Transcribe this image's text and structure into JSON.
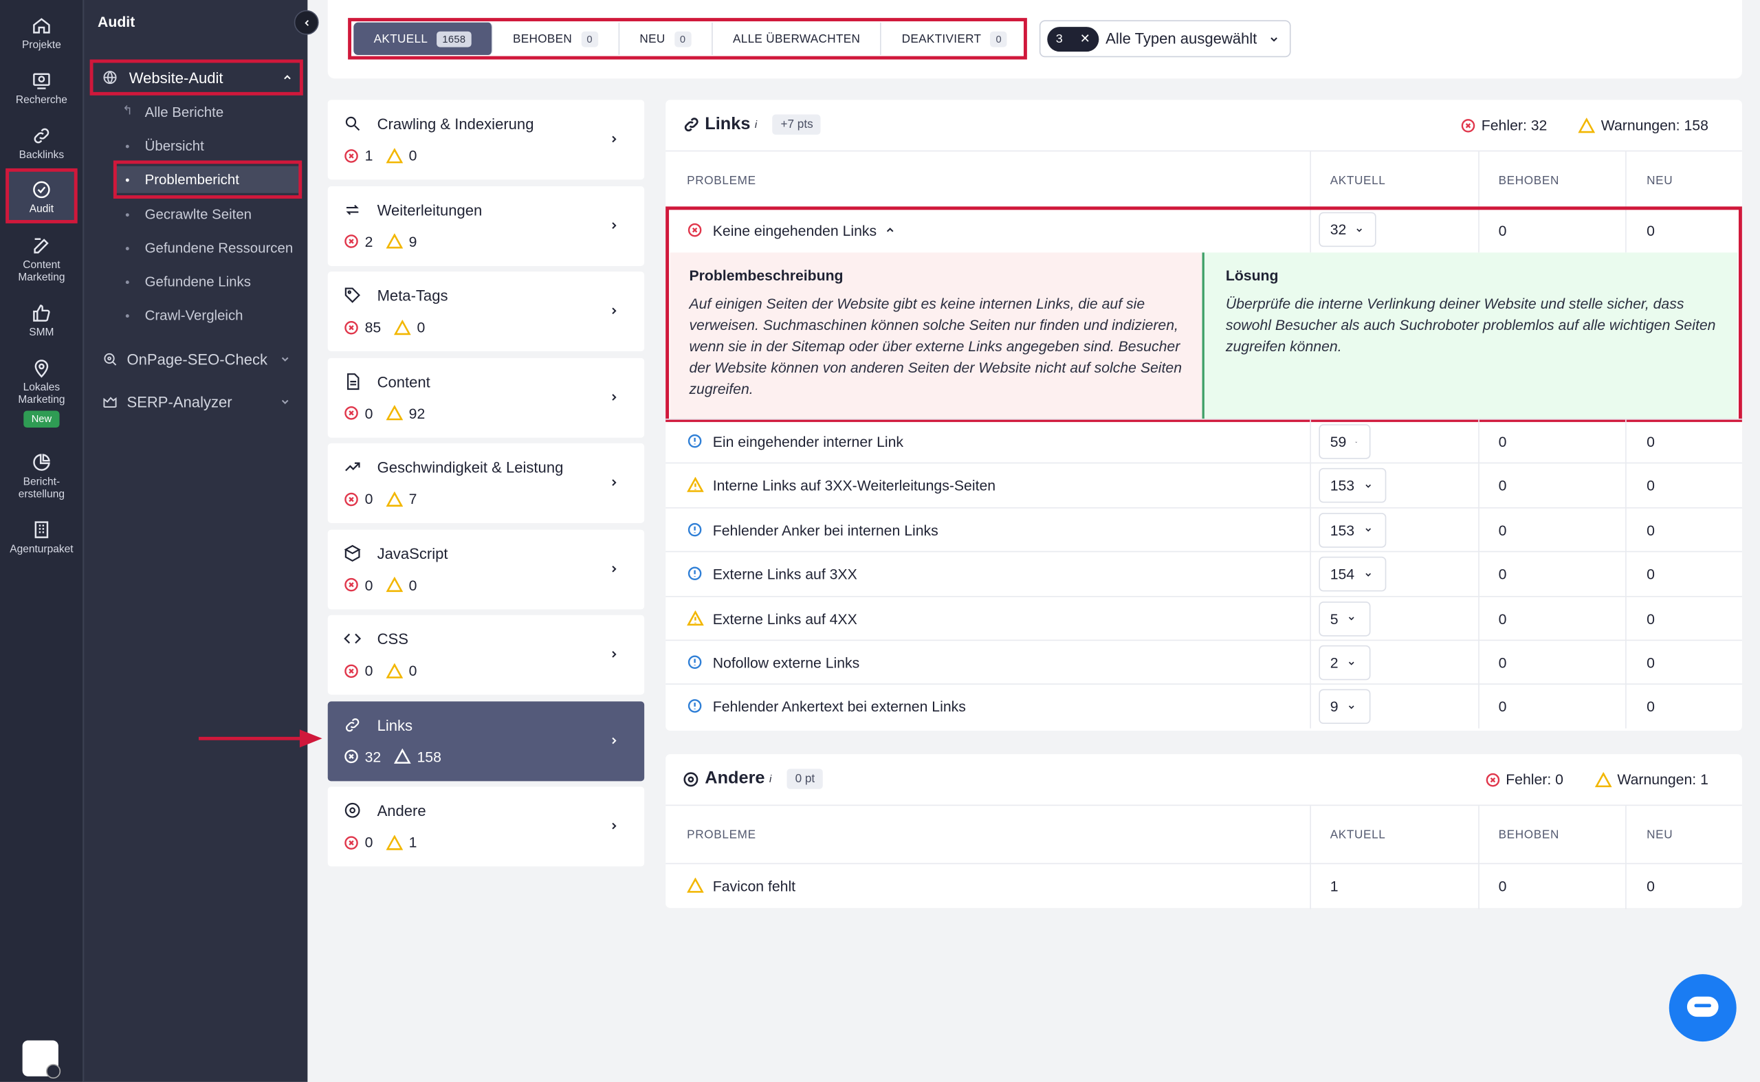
{
  "rail": [
    {
      "label": "Projekte",
      "icon": "home-icon"
    },
    {
      "label": "Recherche",
      "icon": "research-icon"
    },
    {
      "label": "Backlinks",
      "icon": "link-icon"
    },
    {
      "label": "Audit",
      "icon": "audit-check-icon"
    },
    {
      "label": "Content Marketing",
      "icon": "edit-icon"
    },
    {
      "label": "SMM",
      "icon": "thumbs-up-icon"
    },
    {
      "label": "Lokales Marketing",
      "icon": "map-pin-icon",
      "badge": "New"
    },
    {
      "label": "Bericht-erstellung",
      "icon": "pie-chart-icon"
    },
    {
      "label": "Agenturpaket",
      "icon": "building-icon"
    }
  ],
  "sidebar": {
    "title": "Audit",
    "website_audit": "Website-Audit",
    "subitems": [
      "Alle Berichte",
      "Übersicht",
      "Problembericht",
      "Gecrawlte Seiten",
      "Gefundene Ressourcen",
      "Gefundene Links",
      "Crawl-Vergleich"
    ],
    "onpage": "OnPage-SEO-Check",
    "serp": "SERP-Analyzer"
  },
  "filter": {
    "tabs": [
      {
        "label": "AKTUELL",
        "count": "1658"
      },
      {
        "label": "BEHOBEN",
        "count": "0"
      },
      {
        "label": "NEU",
        "count": "0"
      },
      {
        "label": "ALLE ÜBERWACHTEN",
        "count": ""
      },
      {
        "label": "DEAKTIVIERT",
        "count": "0"
      }
    ],
    "type_count": "3",
    "type_label": "Alle Typen ausgewählt"
  },
  "categories": [
    {
      "name": "Crawling & Indexierung",
      "errors": "1",
      "warnings": "0",
      "icon": "search-icon"
    },
    {
      "name": "Weiterleitungen",
      "errors": "2",
      "warnings": "9",
      "icon": "redirect-icon"
    },
    {
      "name": "Meta-Tags",
      "errors": "85",
      "warnings": "0",
      "icon": "tag-icon"
    },
    {
      "name": "Content",
      "errors": "0",
      "warnings": "92",
      "icon": "document-icon"
    },
    {
      "name": "Geschwindigkeit & Leistung",
      "errors": "0",
      "warnings": "7",
      "icon": "trend-icon"
    },
    {
      "name": "JavaScript",
      "errors": "0",
      "warnings": "0",
      "icon": "cube-icon"
    },
    {
      "name": "CSS",
      "errors": "0",
      "warnings": "0",
      "icon": "code-icon"
    },
    {
      "name": "Links",
      "errors": "32",
      "warnings": "158",
      "icon": "link-icon"
    },
    {
      "name": "Andere",
      "errors": "0",
      "warnings": "1",
      "icon": "target-icon"
    }
  ],
  "links_panel": {
    "title": "Links",
    "pts": "+7 pts",
    "errors_label": "Fehler: 32",
    "warnings_label": "Warnungen: 158",
    "columns": [
      "PROBLEME",
      "AKTUELL",
      "BEHOBEN",
      "NEU"
    ],
    "expanded": {
      "label": "Keine eingehenden Links",
      "current": "32",
      "fixed": "0",
      "new": "0",
      "desc_title": "Problembeschreibung",
      "desc_text": "Auf einigen Seiten der Website gibt es keine internen Links, die auf sie verweisen. Suchmaschinen können solche Seiten nur finden und indizieren, wenn sie in der Sitemap oder über externe Links angegeben sind. Besucher der Website können von anderen Seiten der Website nicht auf solche Seiten zugreifen.",
      "solution_title": "Lösung",
      "solution_text": "Überprüfe die interne Verlinkung deiner Website und stelle sicher, dass sowohl Besucher als auch Suchroboter problemlos auf alle wichtigen Seiten zugreifen können."
    },
    "rows": [
      {
        "label": "Ein eingehender interner Link",
        "type": "info",
        "current": "59",
        "fixed": "0",
        "new": "0"
      },
      {
        "label": "Interne Links auf 3XX-Weiterleitungs-Seiten",
        "type": "warning",
        "current": "153",
        "fixed": "0",
        "new": "0"
      },
      {
        "label": "Fehlender Anker bei internen Links",
        "type": "info",
        "current": "153",
        "fixed": "0",
        "new": "0"
      },
      {
        "label": "Externe Links auf 3XX",
        "type": "info",
        "current": "154",
        "fixed": "0",
        "new": "0"
      },
      {
        "label": "Externe Links auf 4XX",
        "type": "warning",
        "current": "5",
        "fixed": "0",
        "new": "0"
      },
      {
        "label": "Nofollow externe Links",
        "type": "info",
        "current": "2",
        "fixed": "0",
        "new": "0"
      },
      {
        "label": "Fehlender Ankertext bei externen Links",
        "type": "info",
        "current": "9",
        "fixed": "0",
        "new": "0"
      }
    ]
  },
  "andere_panel": {
    "title": "Andere",
    "pts": "0 pt",
    "errors_label": "Fehler: 0",
    "warnings_label": "Warnungen: 1",
    "columns": [
      "PROBLEME",
      "AKTUELL",
      "BEHOBEN",
      "NEU"
    ],
    "rows": [
      {
        "label": "Favicon fehlt",
        "type": "warning",
        "current": "1",
        "fixed": "0",
        "new": "0"
      }
    ]
  },
  "colors": {
    "accent": "#545a7a",
    "error": "#e0364b",
    "warning": "#f2b600",
    "info": "#2f7fd6",
    "highlight": "#d0183b",
    "chat": "#1a7cf3"
  }
}
